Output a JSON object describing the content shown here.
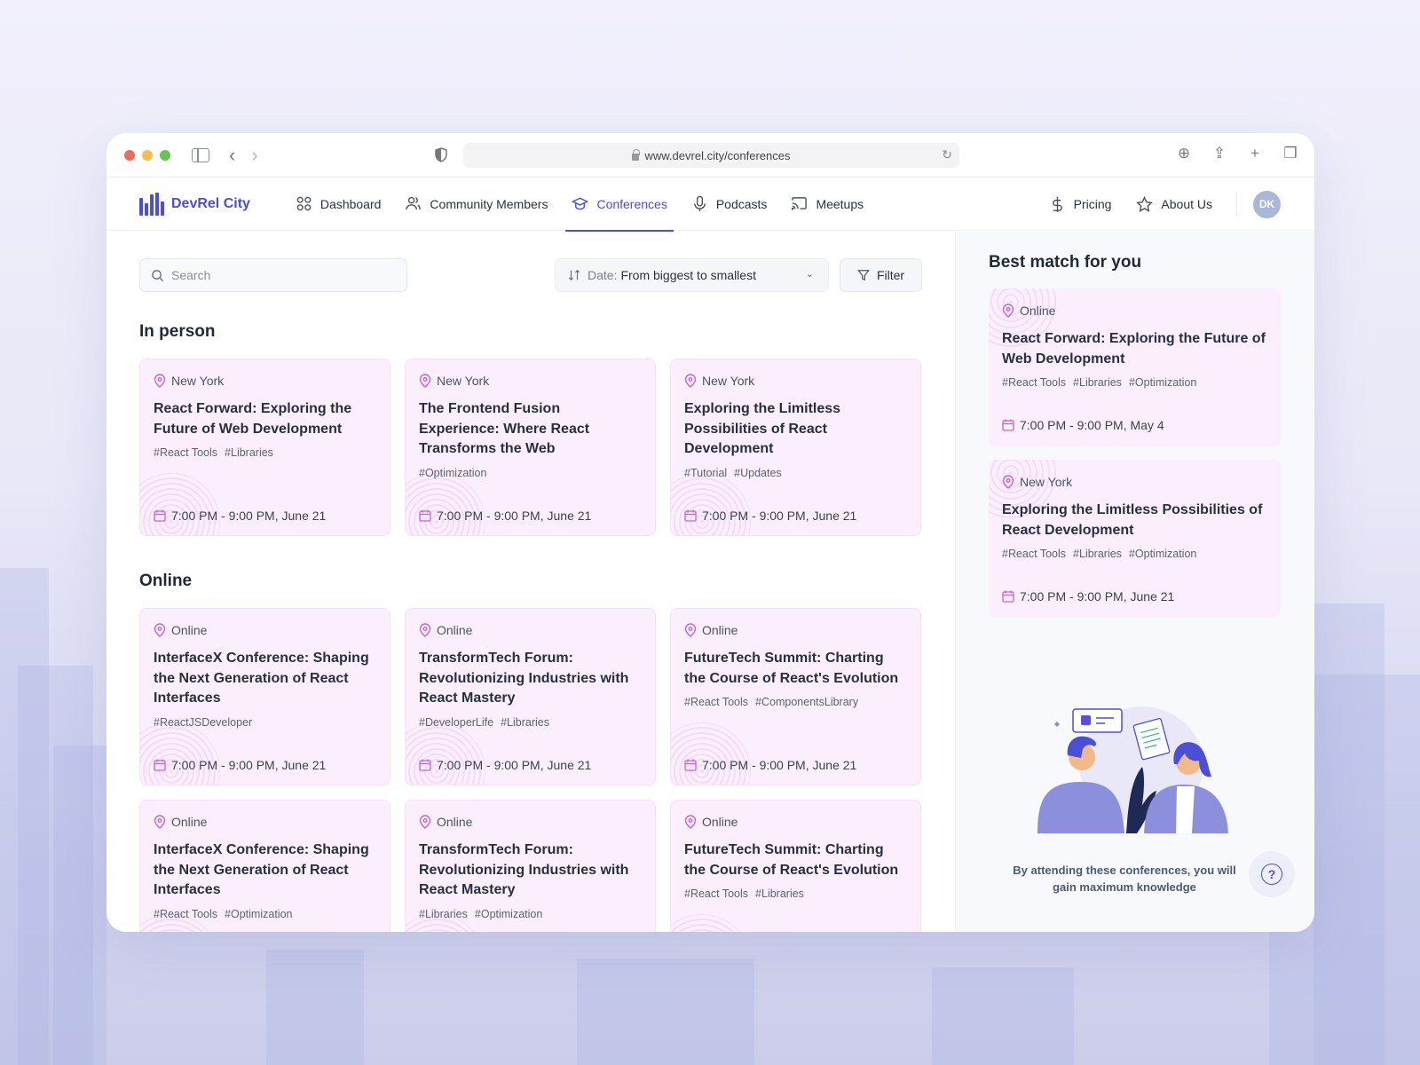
{
  "browser": {
    "url": "www.devrel.city/conferences"
  },
  "nav": {
    "brand": "DevRel City",
    "items": [
      {
        "label": "Dashboard",
        "icon": "grid-icon"
      },
      {
        "label": "Community Members",
        "icon": "users-icon"
      },
      {
        "label": "Conferences",
        "icon": "graduation-cap-icon",
        "active": true
      },
      {
        "label": "Podcasts",
        "icon": "microphone-icon"
      },
      {
        "label": "Meetups",
        "icon": "cast-icon"
      }
    ],
    "right_items": [
      {
        "label": "Pricing",
        "icon": "dollar-icon"
      },
      {
        "label": "About Us",
        "icon": "star-icon"
      }
    ],
    "avatar_initials": "DK"
  },
  "toolbar": {
    "search_placeholder": "Search",
    "sort_prefix": "Date:",
    "sort_value": "From biggest to smallest",
    "filter_label": "Filter"
  },
  "sections": {
    "in_person": {
      "title": "In person",
      "cards": [
        {
          "location": "New York",
          "title": "React Forward: Exploring the Future of Web Development",
          "tags": [
            "#React Tools",
            "#Libraries"
          ],
          "date": "7:00 PM - 9:00 PM, June 21"
        },
        {
          "location": "New York",
          "title": "The Frontend Fusion Experience: Where React Transforms the Web",
          "tags": [
            "#Optimization"
          ],
          "date": "7:00 PM - 9:00 PM, June 21"
        },
        {
          "location": "New York",
          "title": "Exploring the Limitless Possibilities of React Development",
          "tags": [
            "#Tutorial",
            "#Updates"
          ],
          "date": "7:00 PM - 9:00 PM, June 21"
        }
      ]
    },
    "online": {
      "title": "Online",
      "cards": [
        {
          "location": "Online",
          "title": "InterfaceX Conference: Shaping the Next Generation of React Interfaces",
          "tags": [
            "#ReactJSDeveloper"
          ],
          "date": "7:00 PM - 9:00 PM, June 21"
        },
        {
          "location": "Online",
          "title": "TransformTech Forum: Revolutionizing Industries with React Mastery",
          "tags": [
            "#DeveloperLife",
            "#Libraries"
          ],
          "date": "7:00 PM - 9:00 PM, June 21"
        },
        {
          "location": "Online",
          "title": "FutureTech Summit: Charting the Course of React's Evolution",
          "tags": [
            "#React Tools",
            "#ComponentsLibrary"
          ],
          "date": "7:00 PM - 9:00 PM, June 21"
        },
        {
          "location": "Online",
          "title": "InterfaceX Conference: Shaping the Next Generation of React Interfaces",
          "tags": [
            "#React Tools",
            "#Optimization"
          ],
          "date": ""
        },
        {
          "location": "Online",
          "title": "TransformTech Forum: Revolutionizing Industries with React Mastery",
          "tags": [
            "#Libraries",
            "#Optimization"
          ],
          "date": ""
        },
        {
          "location": "Online",
          "title": "FutureTech Summit: Charting the Course of React's Evolution",
          "tags": [
            "#React Tools",
            "#Libraries"
          ],
          "date": ""
        }
      ]
    }
  },
  "sidebar": {
    "title": "Best match for you",
    "cards": [
      {
        "location": "Online",
        "title": "React Forward: Exploring the Future of Web Development",
        "tags": [
          "#React Tools",
          "#Libraries",
          "#Optimization"
        ],
        "date": "7:00 PM - 9:00 PM, May 4"
      },
      {
        "location": "New York",
        "title": "Exploring the Limitless Possibilities of React Development",
        "tags": [
          "#React Tools",
          "#Libraries",
          "#Optimization"
        ],
        "date": "7:00 PM - 9:00 PM, June 21"
      }
    ],
    "note": "By attending these conferences, you will gain maximum knowledge",
    "help_icon": "question-icon"
  },
  "colors": {
    "accent": "#4b4fd6",
    "card_bg": "#fbeffd",
    "icon_pink": "#c066d6"
  }
}
